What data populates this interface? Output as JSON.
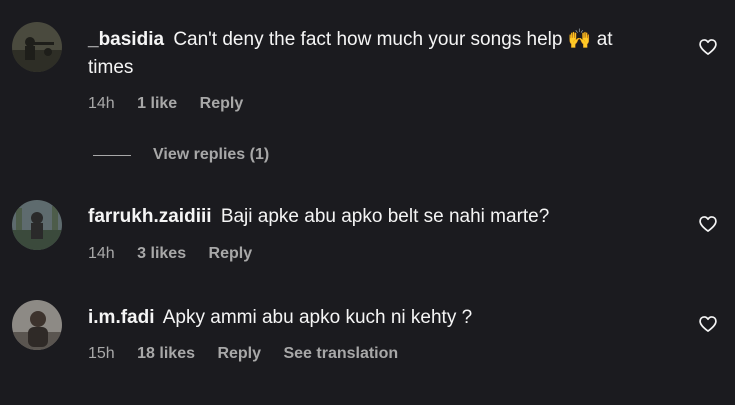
{
  "comments": [
    {
      "username": "_basidia",
      "text_before_emoji": "Can't deny the fact how much your songs help",
      "emoji": "🙌",
      "text_after_emoji": "at times",
      "time": "14h",
      "likes": "1 like",
      "reply": "Reply",
      "view_replies": "View replies (1)"
    },
    {
      "username": "farrukh.zaidiii",
      "text": "Baji apke abu apko belt se nahi marte?",
      "time": "14h",
      "likes": "3 likes",
      "reply": "Reply"
    },
    {
      "username": "i.m.fadi",
      "text": "Apky ammi abu apko kuch ni kehty ?",
      "time": "15h",
      "likes": "18 likes",
      "reply": "Reply",
      "see_translation": "See translation"
    }
  ],
  "icons": {
    "like": "heart-outline-icon"
  },
  "colors": {
    "background": "#1b1b1f",
    "primary_text": "#f5f5f5",
    "secondary_text": "#a8a8a8"
  }
}
